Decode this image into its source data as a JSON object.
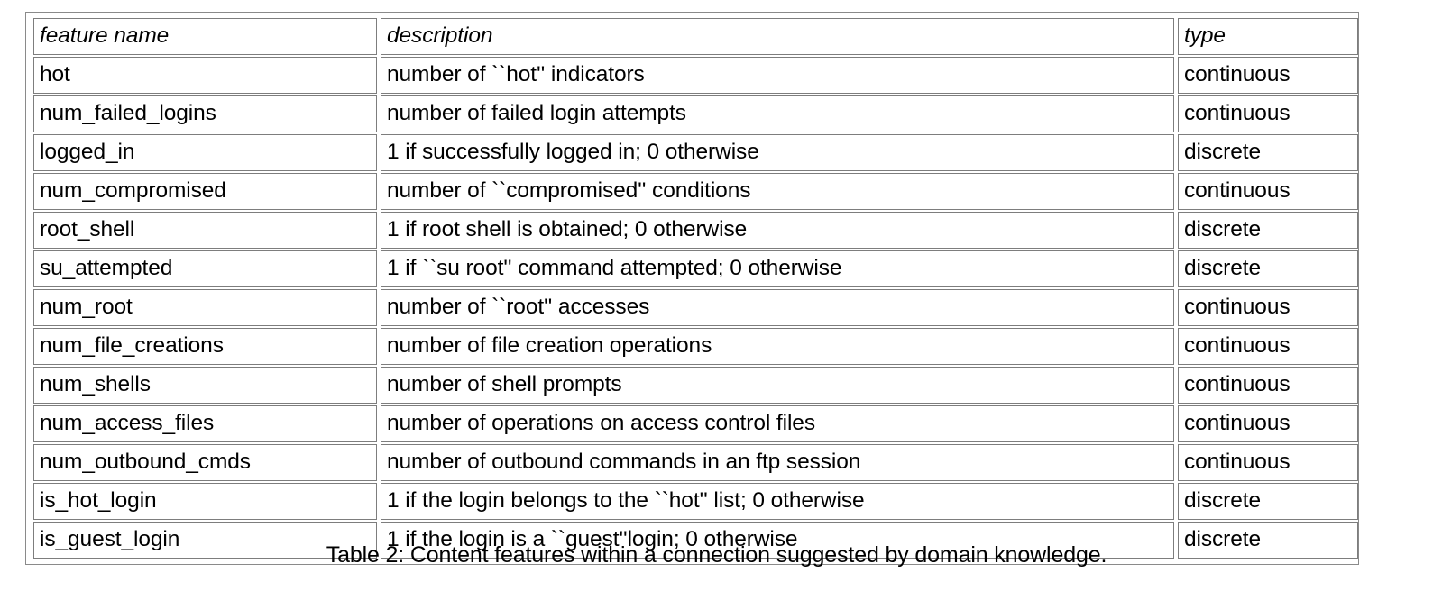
{
  "table": {
    "columns": [
      {
        "key": "feature_name",
        "header": "feature name"
      },
      {
        "key": "description",
        "header": "description"
      },
      {
        "key": "type",
        "header": "type"
      }
    ],
    "rows": [
      {
        "feature_name": "hot",
        "description": "number of ``hot'' indicators",
        "type": "continuous"
      },
      {
        "feature_name": "num_failed_logins",
        "description": "number of failed login attempts",
        "type": "continuous"
      },
      {
        "feature_name": "logged_in",
        "description": "1 if successfully logged in; 0 otherwise",
        "type": "discrete"
      },
      {
        "feature_name": "num_compromised",
        "description": "number of ``compromised'' conditions",
        "type": "continuous"
      },
      {
        "feature_name": "root_shell",
        "description": "1 if root shell is obtained; 0 otherwise",
        "type": "discrete"
      },
      {
        "feature_name": "su_attempted",
        "description": "1 if ``su root'' command attempted; 0 otherwise",
        "type": "discrete"
      },
      {
        "feature_name": "num_root",
        "description": "number of ``root'' accesses",
        "type": "continuous"
      },
      {
        "feature_name": "num_file_creations",
        "description": "number of file creation operations",
        "type": "continuous"
      },
      {
        "feature_name": "num_shells",
        "description": "number of shell prompts",
        "type": "continuous"
      },
      {
        "feature_name": "num_access_files",
        "description": "number of operations on access control files",
        "type": "continuous"
      },
      {
        "feature_name": "num_outbound_cmds",
        "description": "number of outbound commands in an ftp session",
        "type": "continuous"
      },
      {
        "feature_name": "is_hot_login",
        "description": "1 if the login belongs to the ``hot'' list; 0 otherwise",
        "type": "discrete"
      },
      {
        "feature_name": "is_guest_login",
        "description": "1 if the login is a ``guest''login; 0 otherwise",
        "type": "discrete"
      }
    ]
  },
  "caption": {
    "text": "Table 2: Content features within a connection suggested by domain knowledge."
  },
  "colors": {
    "page_background": "#ffffff",
    "text": "#000000",
    "outer_border": "#8a8a8a",
    "cell_border": "#7d7d7d"
  }
}
